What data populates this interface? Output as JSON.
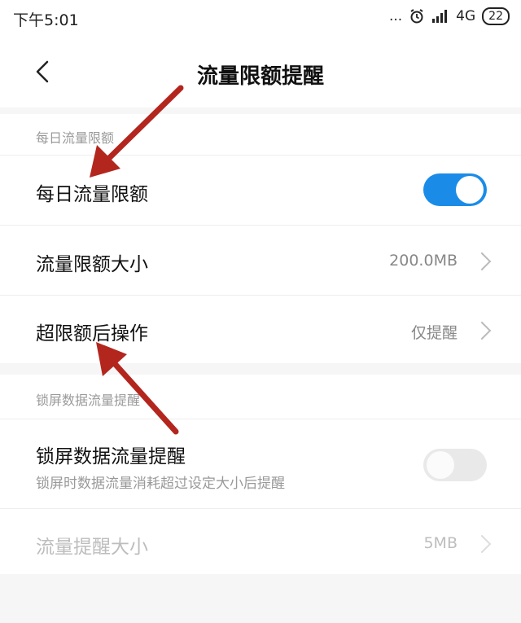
{
  "status_bar": {
    "time": "下午5:01",
    "dots": "...",
    "network": "4G",
    "battery": "22"
  },
  "header": {
    "title": "流量限额提醒"
  },
  "section1": {
    "title": "每日流量限额",
    "rows": [
      {
        "label": "每日流量限额",
        "toggle_on": true
      },
      {
        "label": "流量限额大小",
        "value": "200.0MB"
      },
      {
        "label": "超限额后操作",
        "value": "仅提醒"
      }
    ]
  },
  "section2": {
    "title": "锁屏数据流量提醒",
    "rows": [
      {
        "label": "锁屏数据流量提醒",
        "sub": "锁屏时数据流量消耗超过设定大小后提醒",
        "toggle_on": false
      },
      {
        "label": "流量提醒大小",
        "value": "5MB",
        "disabled": true
      }
    ]
  },
  "colors": {
    "accent": "#1a8ce8",
    "arrow": "#b3261e"
  },
  "icons": {
    "back": "chevron-left-icon",
    "alarm": "alarm-icon",
    "signal": "signal-icon"
  }
}
